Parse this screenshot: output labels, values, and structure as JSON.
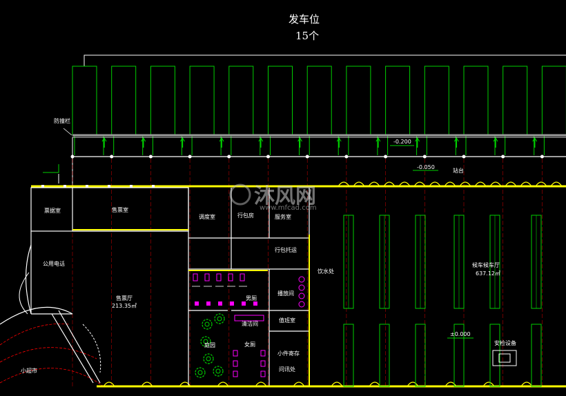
{
  "header": {
    "title": "发车位",
    "count": "15个"
  },
  "labels": {
    "fence": "防撞栏",
    "platform": "站台",
    "level_neg_020": "-0.200",
    "level_neg_005": "-0.050",
    "level_zero": "±0.000",
    "office_left": "票据室",
    "ticket_office": "售票室",
    "dispatch": "调度室",
    "luggage": "行包房",
    "service": "服务室",
    "luggage_counter": "行包托运",
    "public_phone": "公用电话",
    "ticket_hall": "售票厅",
    "ticket_hall_area": "213.35㎡",
    "mens_wc": "男厕",
    "broadcast": "播放间",
    "watch": "值班室",
    "drinking_water": "饮水处",
    "garden": "庭园",
    "cleaning": "清洁间",
    "womens_wc": "女厕",
    "lost_found": "小件寄存",
    "inquiry": "问讯处",
    "waiting_hall": "候车候车厅",
    "waiting_area": "637.12㎡",
    "security": "安检设备",
    "shop": "小超市"
  },
  "watermark": {
    "brand": "沐风网",
    "url": "www.mfcad.com"
  },
  "colors": {
    "green": "#00d000",
    "yellow": "#ffff00",
    "white": "#ffffff",
    "magenta": "#ff00ff",
    "grey": "#9a9a9a",
    "red": "#ff0000"
  }
}
